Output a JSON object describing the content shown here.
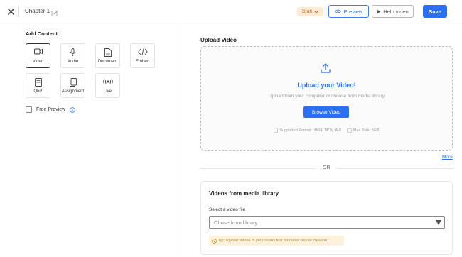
{
  "header": {
    "chapter_title": "Chapter 1",
    "status_badge": "Draft",
    "preview_label": "Preview",
    "help_video_label": "Help video",
    "save_label": "Save"
  },
  "left_panel": {
    "add_content_title": "Add Content",
    "content_types": [
      {
        "label": "Video",
        "icon": "video-icon",
        "selected": true
      },
      {
        "label": "Audio",
        "icon": "microphone-icon",
        "selected": false
      },
      {
        "label": "Document",
        "icon": "document-icon",
        "selected": false
      },
      {
        "label": "Embed",
        "icon": "code-icon",
        "selected": false
      },
      {
        "label": "Quiz",
        "icon": "quiz-icon",
        "selected": false
      },
      {
        "label": "Assignment",
        "icon": "assignment-icon",
        "selected": false
      },
      {
        "label": "Live",
        "icon": "live-icon",
        "selected": false
      }
    ],
    "free_preview_label": "Free Preview",
    "free_preview_checked": false
  },
  "upload": {
    "section_title": "Upload Video",
    "heading": "Upload your Video!",
    "subtext": "Upload from your computer or choose from media library",
    "browse_label": "Browse Video",
    "supported_formats": "Supported Format : MP4, MOV, AVI",
    "max_size": "Max Size: 5GB",
    "more_link": "More",
    "or_text": "OR"
  },
  "library": {
    "title": "Videos from media library",
    "select_label": "Select a video file",
    "select_placeholder": "Chose from library",
    "tip": "Tip: Upload videos to your library first for faster course creation"
  },
  "colors": {
    "accent": "#2b6ff2",
    "draft_bg": "#fdebd6",
    "draft_text": "#b36a1c",
    "tip_bg": "#fcf2dc",
    "tip_text": "#b58a2c"
  }
}
